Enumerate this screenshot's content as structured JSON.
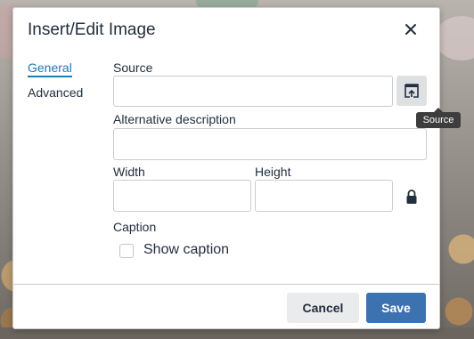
{
  "dialog": {
    "title": "Insert/Edit Image",
    "close_icon": "close-icon"
  },
  "tabs": [
    {
      "label": "General",
      "active": true
    },
    {
      "label": "Advanced",
      "active": false
    }
  ],
  "form": {
    "source_label": "Source",
    "source_value": "",
    "browse_icon": "upload-icon",
    "browse_tooltip": "Source",
    "alt_label": "Alternative description",
    "alt_value": "",
    "width_label": "Width",
    "width_value": "",
    "height_label": "Height",
    "height_value": "",
    "lock_icon": "lock-icon",
    "caption_label": "Caption",
    "show_caption_label": "Show caption",
    "show_caption_checked": false
  },
  "footer": {
    "cancel_label": "Cancel",
    "save_label": "Save"
  },
  "colors": {
    "accent": "#207ab7",
    "primary_button": "#3d72b0",
    "text": "#222f3e"
  }
}
